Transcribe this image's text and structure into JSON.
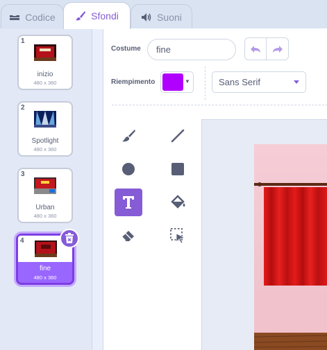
{
  "tabs": [
    {
      "label": "Codice",
      "icon": "code-icon"
    },
    {
      "label": "Sfondi",
      "icon": "paintbrush-icon"
    },
    {
      "label": "Suoni",
      "icon": "speaker-icon"
    }
  ],
  "backdrops": [
    {
      "number": "1",
      "name": "inizio",
      "size": "480 x 360"
    },
    {
      "number": "2",
      "name": "Spotlight",
      "size": "480 x 360"
    },
    {
      "number": "3",
      "name": "Urban",
      "size": "480 x 360"
    },
    {
      "number": "4",
      "name": "fine",
      "size": "480 x 360"
    }
  ],
  "editor": {
    "costume_label": "Costume",
    "costume_value": "fine",
    "fill_label": "Riempimento",
    "fill_color": "#b000ff",
    "font_value": "Sans Serif"
  },
  "tools": [
    {
      "name": "brush-tool",
      "icon": "brush-icon"
    },
    {
      "name": "line-tool",
      "icon": "line-icon"
    },
    {
      "name": "circle-tool",
      "icon": "circle-icon"
    },
    {
      "name": "rectangle-tool",
      "icon": "rectangle-icon"
    },
    {
      "name": "text-tool",
      "icon": "text-icon",
      "active": true
    },
    {
      "name": "fill-tool",
      "icon": "fill-bucket-icon"
    },
    {
      "name": "eraser-tool",
      "icon": "eraser-icon"
    },
    {
      "name": "select-tool",
      "icon": "select-icon"
    }
  ],
  "colors": {
    "accent": "#855cd6",
    "selected_thumb": "#9966ff",
    "curtain": "#d91515"
  }
}
